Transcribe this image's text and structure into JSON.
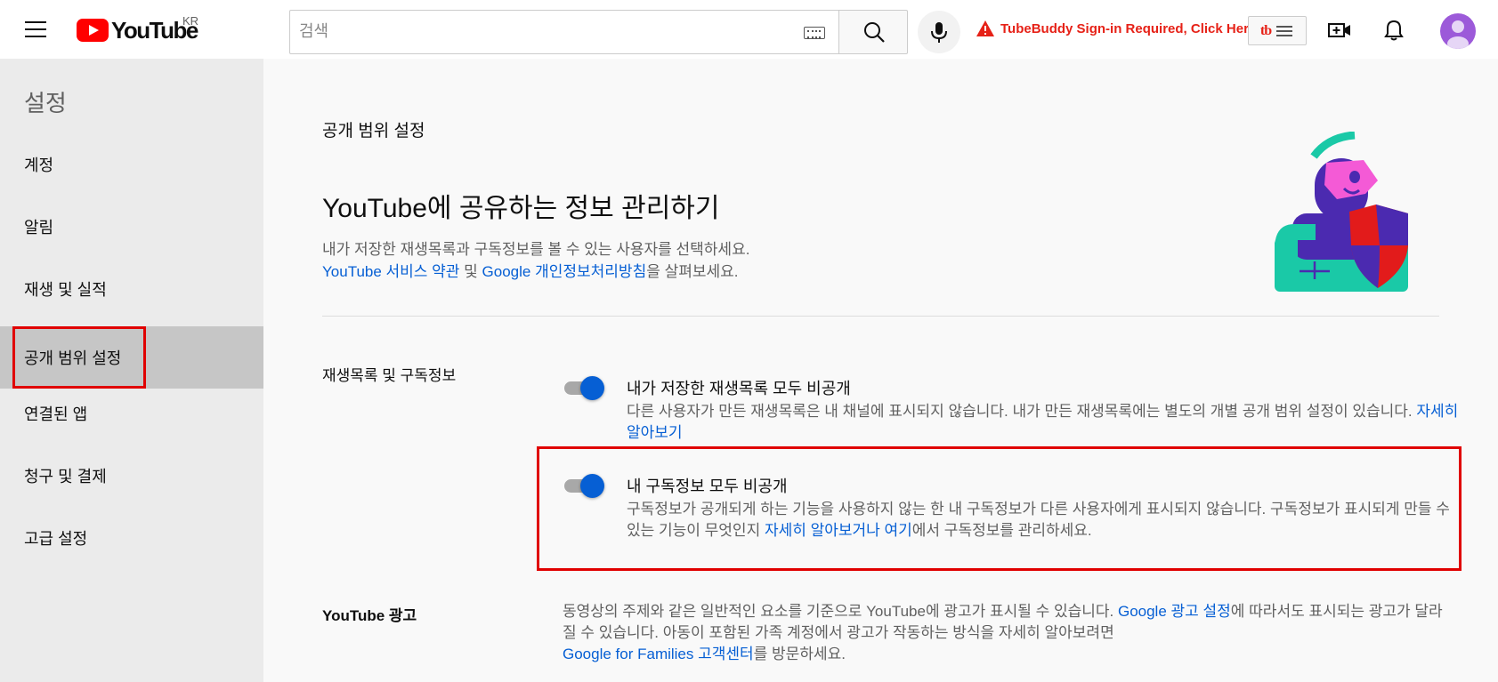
{
  "header": {
    "logo_text": "YouTube",
    "region": "KR",
    "search_placeholder": "검색",
    "tubebuddy_warning": "TubeBuddy Sign-in Required, Click Here",
    "tubebuddy_logo": "tb",
    "icons": [
      "menu-icon",
      "keyboard-icon",
      "search-icon",
      "mic-icon",
      "warning-icon",
      "tubebuddy-menu-icon",
      "create-video-icon",
      "notifications-icon",
      "avatar"
    ],
    "colors": {
      "brand_red": "#ff0000",
      "warning_red": "#e62117",
      "link_blue": "#065fd4",
      "highlight_red": "#e00000"
    }
  },
  "sidebar": {
    "title": "설정",
    "items": [
      {
        "label": "계정",
        "active": false
      },
      {
        "label": "알림",
        "active": false
      },
      {
        "label": "재생 및 실적",
        "active": false
      },
      {
        "label": "공개 범위 설정",
        "active": true
      },
      {
        "label": "연결된 앱",
        "active": false
      },
      {
        "label": "청구 및 결제",
        "active": false
      },
      {
        "label": "고급 설정",
        "active": false
      }
    ]
  },
  "main": {
    "section_label": "공개 범위 설정",
    "title": "YouTube에 공유하는 정보 관리하기",
    "description": "내가 저장한 재생목록과 구독정보를 볼 수 있는 사용자를 선택하세요.",
    "terms_link": "YouTube 서비스 약관",
    "terms_and": " 및 ",
    "privacy_link": "Google 개인정보처리방침",
    "terms_suffix": "을 살펴보세요.",
    "playlists_section": {
      "label": "재생목록 및 구독정보",
      "options": [
        {
          "title": "내가 저장한 재생목록 모두 비공개",
          "desc": "다른 사용자가 만든 재생목록은 내 채널에 표시되지 않습니다. 내가 만든 재생목록에는 별도의 개별 공개 범위 설정이 있습니다.",
          "link": "자세히 알아보기",
          "enabled": true
        },
        {
          "title": "내 구독정보 모두 비공개",
          "desc_prefix": "구독정보가 공개되게 하는 기능을 사용하지 않는 한 내 구독정보가 다른 사용자에게 표시되지 않습니다. 구독정보가 표시되게 만들 수 있는 기능이 무엇인지 ",
          "link1": "자세히 알아보거나",
          "link_space": " ",
          "link2": "여기",
          "desc_suffix": "에서 구독정보를 관리하세요.",
          "enabled": true
        }
      ]
    },
    "ads_section": {
      "label": "YouTube 광고",
      "desc_prefix": "동영상의 주제와 같은 일반적인 요소를 기준으로 YouTube에 광고가 표시될 수 있습니다. ",
      "ads_link": "Google 광고 설정",
      "desc_middle": "에 따라서도 표시되는 광고가 달라질 수 있습니다. 아동이 포함된 가족 계정에서 광고가 작동하는 방식을 자세히 알아보려면 ",
      "families_link": "Google for Families 고객센터",
      "desc_suffix": "를 방문하세요."
    }
  }
}
